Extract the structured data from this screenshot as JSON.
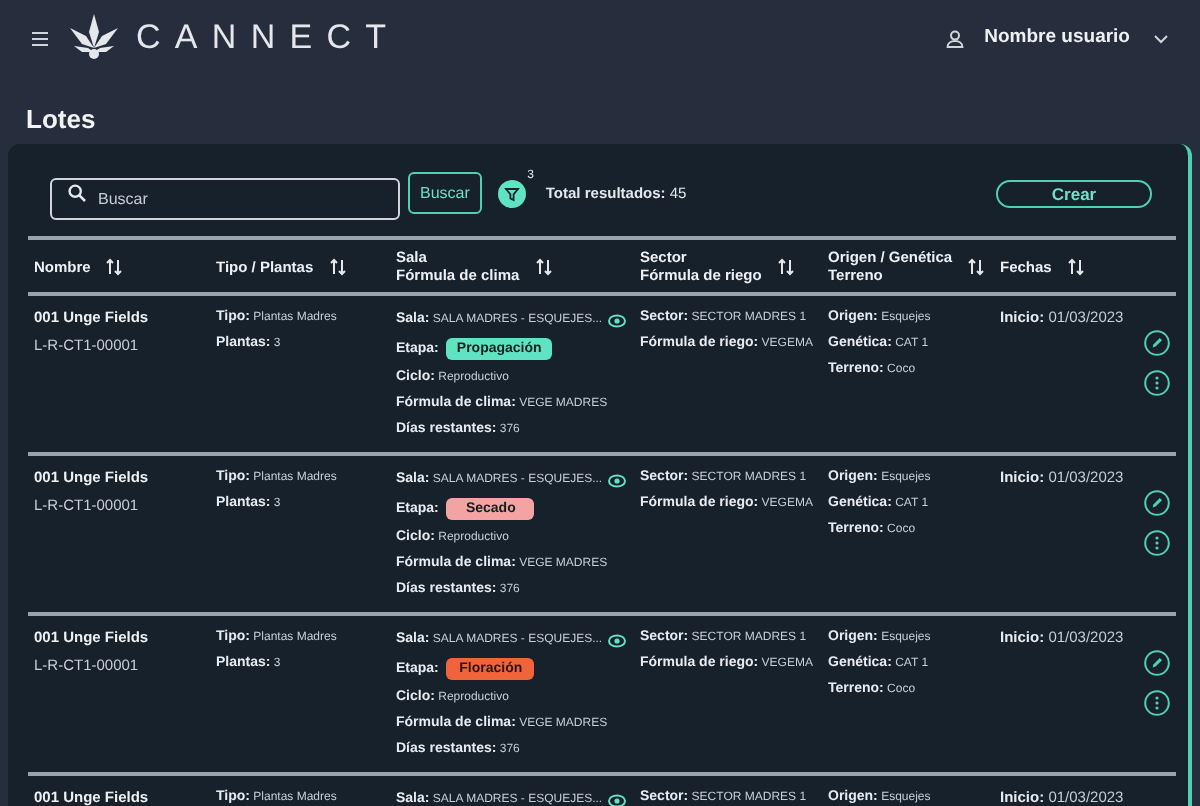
{
  "header": {
    "brand": "CANNECT",
    "user": "Nombre usuario"
  },
  "page_title": "Lotes",
  "toolbar": {
    "search": {
      "placeholder": "Buscar"
    },
    "search_button": "Buscar",
    "filter_count": "3",
    "total_label": "Total resultados:",
    "total_value": "45",
    "create_button": "Crear"
  },
  "table": {
    "columns": [
      {
        "lines": [
          "Nombre"
        ]
      },
      {
        "lines": [
          "Tipo / Plantas"
        ]
      },
      {
        "lines": [
          "Sala",
          "Fórmula de clima"
        ]
      },
      {
        "lines": [
          "Sector",
          "Fórmula de riego"
        ]
      },
      {
        "lines": [
          "Origen / Genética",
          "Terreno"
        ]
      },
      {
        "lines": [
          "Fechas"
        ]
      }
    ],
    "rows": [
      {
        "actions": true,
        "cells": [
          [
            {
              "kind": "title",
              "value": "001 Unge Fields"
            },
            {
              "kind": "code",
              "value": "L-R-CT1-00001"
            }
          ],
          [
            {
              "kind": "text",
              "label": "Tipo:",
              "value": "Plantas Madres"
            },
            {
              "kind": "text",
              "label": "Plantas:",
              "value": "3"
            }
          ],
          [
            {
              "kind": "viewable",
              "label": "Sala:",
              "value": "SALA MADRES -  ESQUEJES..."
            },
            {
              "kind": "badge",
              "label": "Etapa:",
              "value": "Propagación",
              "color": "#5fe3c2"
            },
            {
              "kind": "text",
              "label": "Ciclo:",
              "value": "Reproductivo"
            },
            {
              "kind": "text",
              "label": "Fórmula de clima:",
              "value": "VEGE MADRES"
            },
            {
              "kind": "text",
              "label": "Días restantes:",
              "value": "376"
            }
          ],
          [
            {
              "kind": "text",
              "label": "Sector:",
              "value": "SECTOR MADRES 1"
            },
            {
              "kind": "text",
              "label": "Fórmula de riego:",
              "value": "VEGEMA"
            }
          ],
          [
            {
              "kind": "text",
              "label": "Origen:",
              "value": "Esquejes"
            },
            {
              "kind": "text",
              "label": "Genética:",
              "value": "CAT 1"
            },
            {
              "kind": "text",
              "label": "Terreno:",
              "value": "Coco"
            }
          ],
          [
            {
              "kind": "date",
              "label": "Inicio:",
              "value": "01/03/2023"
            }
          ]
        ]
      },
      {
        "actions": true,
        "cells": [
          [
            {
              "kind": "title",
              "value": "001 Unge Fields"
            },
            {
              "kind": "code",
              "value": "L-R-CT1-00001"
            }
          ],
          [
            {
              "kind": "text",
              "label": "Tipo:",
              "value": "Plantas Madres"
            },
            {
              "kind": "text",
              "label": "Plantas:",
              "value": "3"
            }
          ],
          [
            {
              "kind": "viewable",
              "label": "Sala:",
              "value": "SALA MADRES -  ESQUEJES..."
            },
            {
              "kind": "badge",
              "label": "Etapa:",
              "value": "Secado",
              "color": "#f4a3a3"
            },
            {
              "kind": "text",
              "label": "Ciclo:",
              "value": "Reproductivo"
            },
            {
              "kind": "text",
              "label": "Fórmula de clima:",
              "value": "VEGE MADRES"
            },
            {
              "kind": "text",
              "label": "Días restantes:",
              "value": "376"
            }
          ],
          [
            {
              "kind": "text",
              "label": "Sector:",
              "value": "SECTOR MADRES 1"
            },
            {
              "kind": "text",
              "label": "Fórmula de riego:",
              "value": "VEGEMA"
            }
          ],
          [
            {
              "kind": "text",
              "label": "Origen:",
              "value": "Esquejes"
            },
            {
              "kind": "text",
              "label": "Genética:",
              "value": "CAT 1"
            },
            {
              "kind": "text",
              "label": "Terreno:",
              "value": "Coco"
            }
          ],
          [
            {
              "kind": "date",
              "label": "Inicio:",
              "value": "01/03/2023"
            }
          ]
        ]
      },
      {
        "actions": true,
        "cells": [
          [
            {
              "kind": "title",
              "value": "001 Unge Fields"
            },
            {
              "kind": "code",
              "value": "L-R-CT1-00001"
            }
          ],
          [
            {
              "kind": "text",
              "label": "Tipo:",
              "value": "Plantas Madres"
            },
            {
              "kind": "text",
              "label": "Plantas:",
              "value": "3"
            }
          ],
          [
            {
              "kind": "viewable",
              "label": "Sala:",
              "value": "SALA MADRES -  ESQUEJES..."
            },
            {
              "kind": "badge",
              "label": "Etapa:",
              "value": "Floración",
              "color": "#f0643c"
            },
            {
              "kind": "text",
              "label": "Ciclo:",
              "value": "Reproductivo"
            },
            {
              "kind": "text",
              "label": "Fórmula de clima:",
              "value": "VEGE MADRES"
            },
            {
              "kind": "text",
              "label": "Días restantes:",
              "value": "376"
            }
          ],
          [
            {
              "kind": "text",
              "label": "Sector:",
              "value": "SECTOR MADRES 1"
            },
            {
              "kind": "text",
              "label": "Fórmula de riego:",
              "value": "VEGEMA"
            }
          ],
          [
            {
              "kind": "text",
              "label": "Origen:",
              "value": "Esquejes"
            },
            {
              "kind": "text",
              "label": "Genética:",
              "value": "CAT 1"
            },
            {
              "kind": "text",
              "label": "Terreno:",
              "value": "Coco"
            }
          ],
          [
            {
              "kind": "date",
              "label": "Inicio:",
              "value": "01/03/2023"
            }
          ]
        ]
      },
      {
        "actions": false,
        "cells": [
          [
            {
              "kind": "title",
              "value": "001 Unge Fields"
            }
          ],
          [
            {
              "kind": "text",
              "label": "Tipo:",
              "value": "Plantas Madres"
            }
          ],
          [
            {
              "kind": "viewable",
              "label": "Sala:",
              "value": "SALA MADRES -  ESQUEJES..."
            }
          ],
          [
            {
              "kind": "text",
              "label": "Sector:",
              "value": "SECTOR MADRES 1"
            }
          ],
          [
            {
              "kind": "text",
              "label": "Origen:",
              "value": "Esquejes"
            }
          ],
          [
            {
              "kind": "date",
              "label": "Inicio:",
              "value": "01/03/2023"
            }
          ]
        ]
      }
    ]
  }
}
